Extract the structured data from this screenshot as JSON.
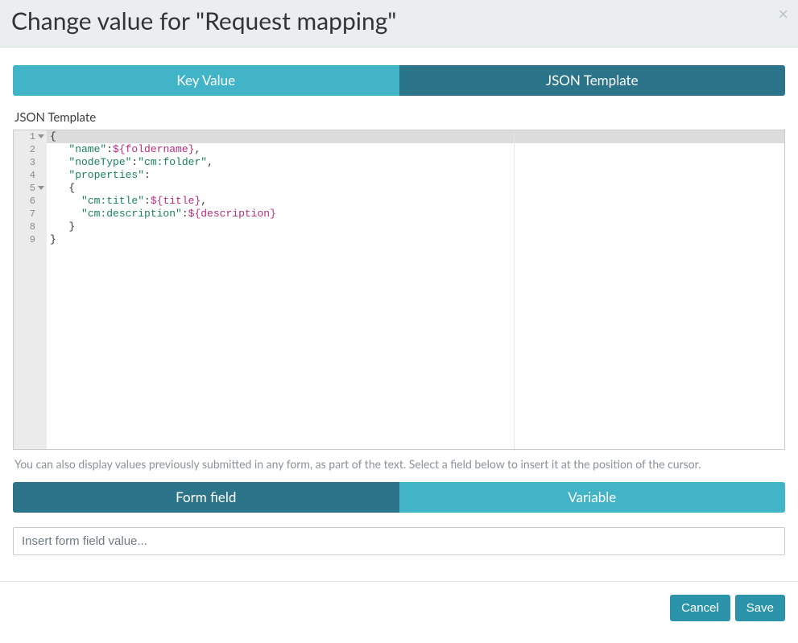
{
  "header": {
    "title": "Change value for \"Request mapping\""
  },
  "tabs_top": {
    "key_value": "Key Value",
    "json_template": "JSON Template",
    "active": "json_template"
  },
  "editor": {
    "label": "JSON Template",
    "lines": [
      {
        "num": "1",
        "fold": true,
        "tokens": [
          {
            "cls": "tk-brace",
            "t": "{"
          }
        ]
      },
      {
        "num": "2",
        "fold": false,
        "tokens": [
          {
            "cls": "",
            "t": "   "
          },
          {
            "cls": "tk-key",
            "t": "\"name\""
          },
          {
            "cls": "tk-colon",
            "t": ":"
          },
          {
            "cls": "tk-var",
            "t": "${foldername}"
          },
          {
            "cls": "tk-comma",
            "t": ","
          }
        ]
      },
      {
        "num": "3",
        "fold": false,
        "tokens": [
          {
            "cls": "",
            "t": "   "
          },
          {
            "cls": "tk-key",
            "t": "\"nodeType\""
          },
          {
            "cls": "tk-colon",
            "t": ":"
          },
          {
            "cls": "tk-str",
            "t": "\"cm:folder\""
          },
          {
            "cls": "tk-comma",
            "t": ","
          }
        ]
      },
      {
        "num": "4",
        "fold": false,
        "tokens": [
          {
            "cls": "",
            "t": "   "
          },
          {
            "cls": "tk-key",
            "t": "\"properties\""
          },
          {
            "cls": "tk-colon",
            "t": ":"
          }
        ]
      },
      {
        "num": "5",
        "fold": true,
        "tokens": [
          {
            "cls": "",
            "t": "   "
          },
          {
            "cls": "tk-brace",
            "t": "{"
          }
        ]
      },
      {
        "num": "6",
        "fold": false,
        "tokens": [
          {
            "cls": "",
            "t": "     "
          },
          {
            "cls": "tk-key",
            "t": "\"cm:title\""
          },
          {
            "cls": "tk-colon",
            "t": ":"
          },
          {
            "cls": "tk-var",
            "t": "${title}"
          },
          {
            "cls": "tk-comma",
            "t": ","
          }
        ]
      },
      {
        "num": "7",
        "fold": false,
        "tokens": [
          {
            "cls": "",
            "t": "     "
          },
          {
            "cls": "tk-key",
            "t": "\"cm:description\""
          },
          {
            "cls": "tk-colon",
            "t": ":"
          },
          {
            "cls": "tk-var",
            "t": "${description}"
          }
        ]
      },
      {
        "num": "8",
        "fold": false,
        "tokens": [
          {
            "cls": "",
            "t": "   "
          },
          {
            "cls": "tk-brace",
            "t": "}"
          }
        ]
      },
      {
        "num": "9",
        "fold": false,
        "tokens": [
          {
            "cls": "tk-brace",
            "t": "}"
          }
        ]
      }
    ]
  },
  "hint": "You can also display values previously submitted in any form, as part of the text. Select a field below to insert it at the position of the cursor.",
  "tabs_insert": {
    "form_field": "Form field",
    "variable": "Variable",
    "active": "form_field"
  },
  "insert_input": {
    "placeholder": "Insert form field value..."
  },
  "footer": {
    "cancel": "Cancel",
    "save": "Save"
  },
  "close_icon": "×"
}
